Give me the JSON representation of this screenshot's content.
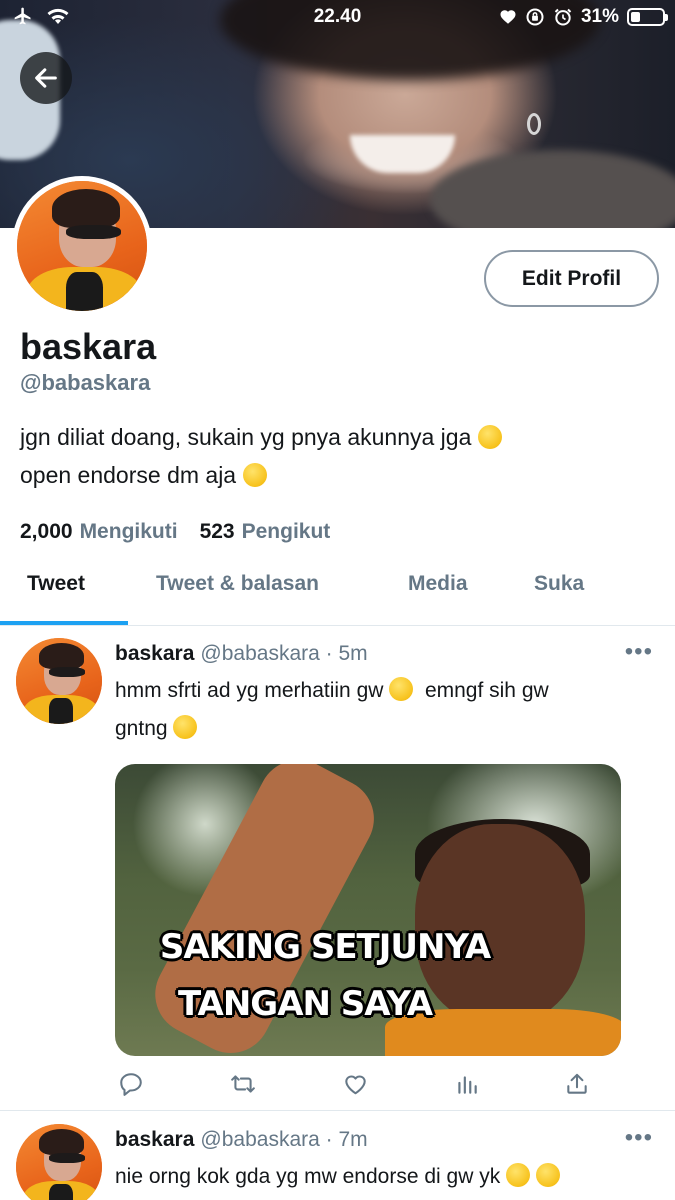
{
  "status_bar": {
    "time": "22.40",
    "battery": "31%",
    "battery_level": 0.31
  },
  "profile": {
    "display_name": "baskara",
    "handle": "@babaskara",
    "edit_button": "Edit Profil",
    "bio_line1": "jgn diliat doang, sukain yg pnya akunnya jga",
    "bio_line2": "open endorse dm aja",
    "following_count": "2,000",
    "following_label": "Mengikuti",
    "followers_count": "523",
    "followers_label": "Pengikut"
  },
  "tabs": [
    {
      "label": "Tweet",
      "active": true
    },
    {
      "label": "Tweet & balasan",
      "active": false
    },
    {
      "label": "Media",
      "active": false
    },
    {
      "label": "Suka",
      "active": false
    }
  ],
  "tweets": [
    {
      "name": "baskara",
      "meta": "@babaskara · 5m",
      "text_line1": "hmm sfrti ad yg merhatiin gw",
      "text_line1b": "emngf sih gw",
      "text_line2": "gntng",
      "media_caption_line1": "SAKING SETJUNYA",
      "media_caption_line2": "TANGAN SAYA"
    },
    {
      "name": "baskara",
      "meta": "@babaskara · 7m",
      "text_line1": "nie orng kok gda yg mw endorse di gw yk"
    }
  ],
  "icons": {
    "back": "arrow-left-icon",
    "more": "more-icon",
    "reply": "reply-icon",
    "retweet": "retweet-icon",
    "like": "heart-icon",
    "analytics": "analytics-icon",
    "share": "share-icon"
  },
  "colors": {
    "accent": "#1da1f2",
    "secondary_text": "#657786",
    "primary_text": "#14171a",
    "divider": "#e1e8ed"
  }
}
